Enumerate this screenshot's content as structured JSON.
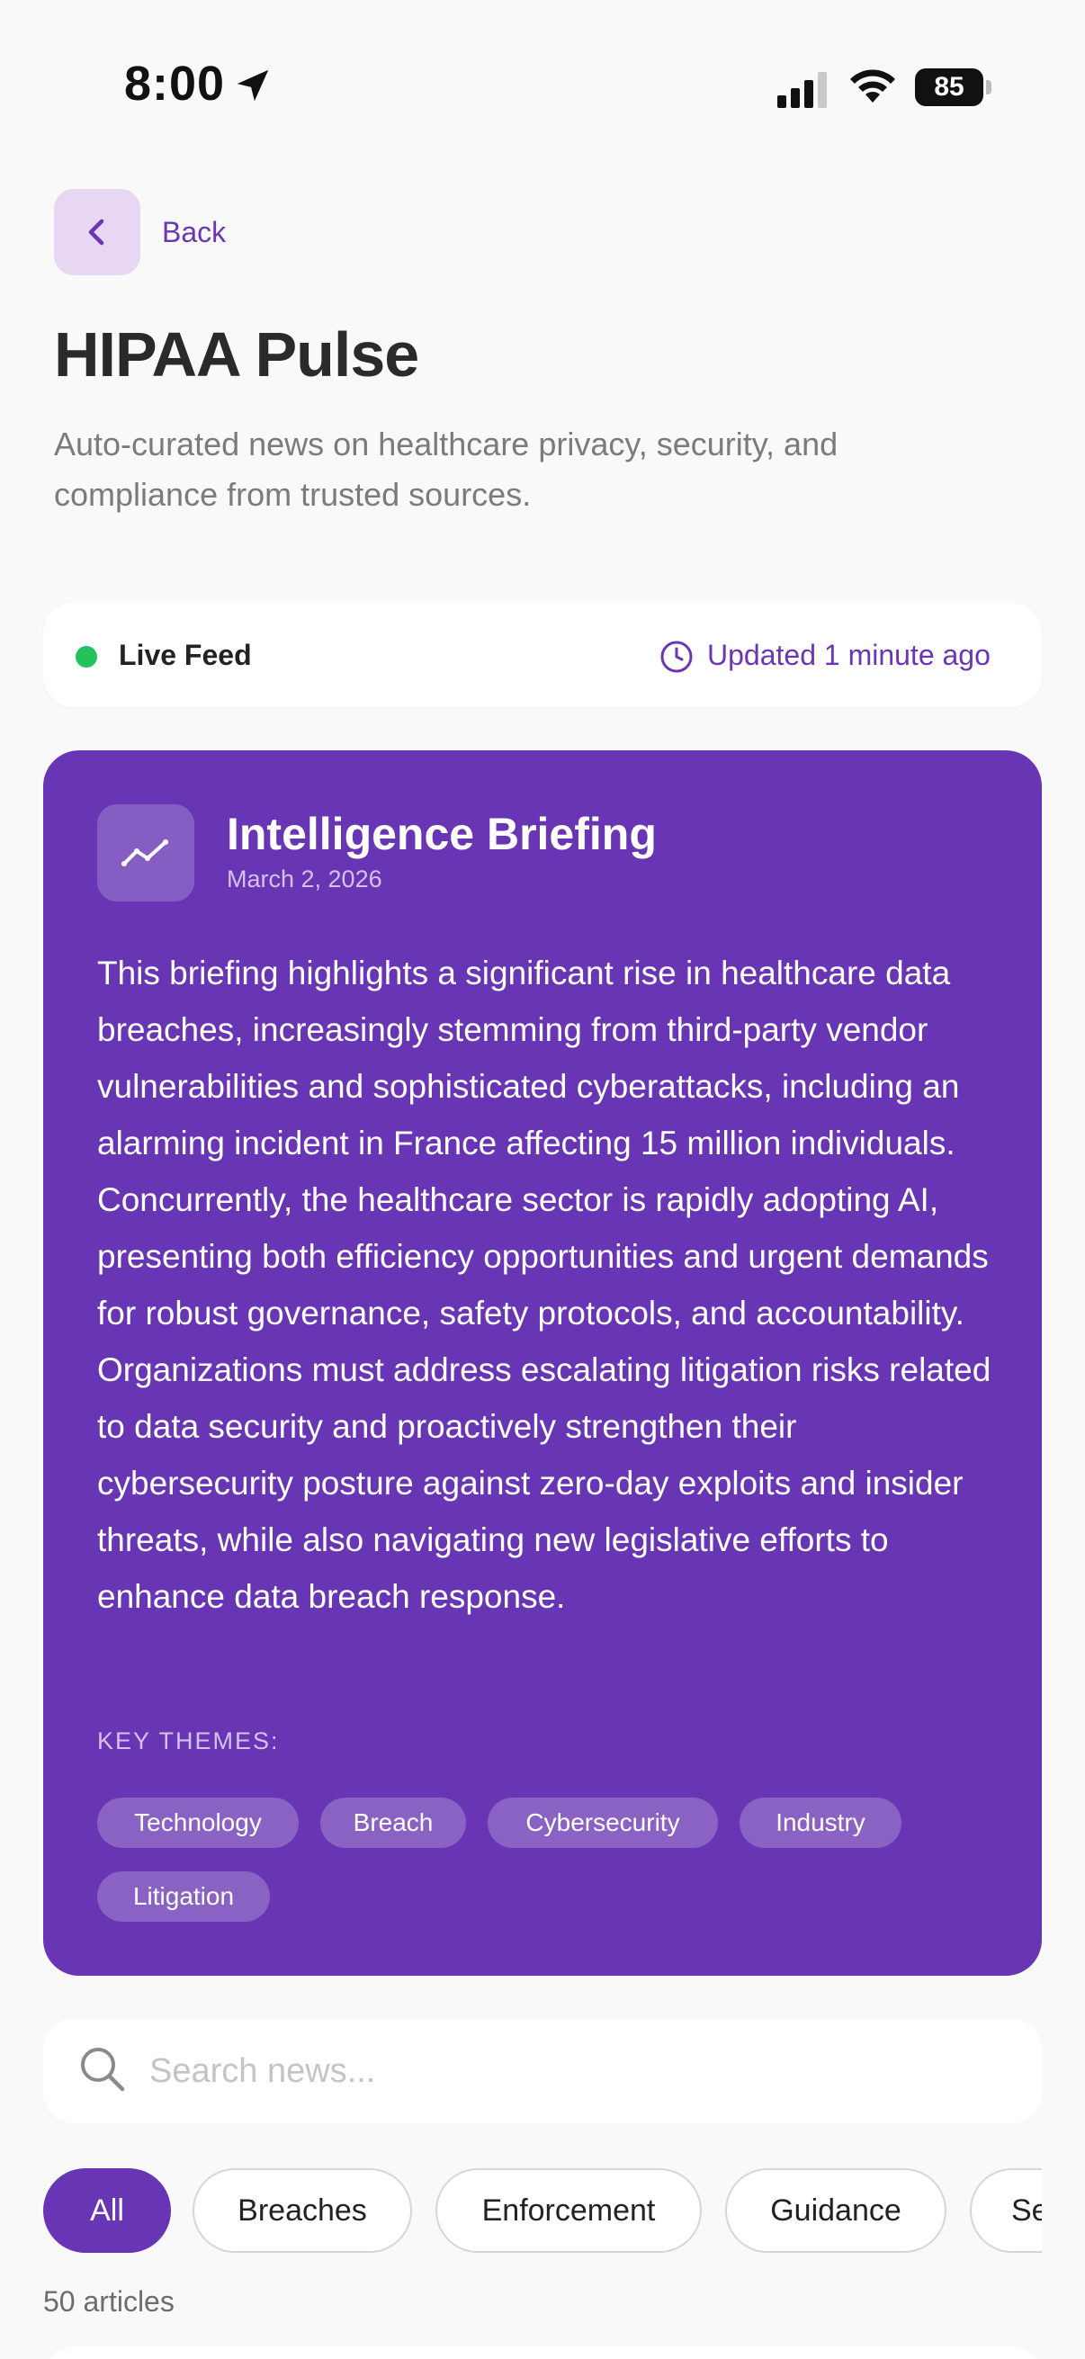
{
  "status_bar": {
    "time": "8:00",
    "battery": "85"
  },
  "header": {
    "back_label": "Back",
    "title": "HIPAA Pulse",
    "subtitle": "Auto-curated news on healthcare privacy, security, and compliance from trusted sources."
  },
  "live_feed": {
    "label": "Live Feed",
    "updated": "Updated 1 minute ago",
    "dot_color": "#22c35e"
  },
  "briefing": {
    "title": "Intelligence Briefing",
    "date": "March 2, 2026",
    "body": "This briefing highlights a significant rise in healthcare data breaches, increasingly stemming from third-party vendor vulnerabilities and sophisticated cyberattacks, including an alarming incident in France affecting 15 million individuals. Concurrently, the healthcare sector is rapidly adopting AI, presenting both efficiency opportunities and urgent demands for robust governance, safety protocols, and accountability. Organizations must address escalating litigation risks related to data security and proactively strengthen their cybersecurity posture against zero-day exploits and insider threats, while also navigating new legislative efforts to enhance data breach response.",
    "key_themes_label": "KEY THEMES:",
    "themes": [
      "Technology",
      "Breach",
      "Cybersecurity",
      "Industry",
      "Litigation"
    ],
    "accent_color": "#6836b4"
  },
  "search": {
    "placeholder": "Search news..."
  },
  "filters": {
    "chips": [
      "All",
      "Breaches",
      "Enforcement",
      "Guidance",
      "Se"
    ],
    "selected": "All"
  },
  "article_count": "50 articles"
}
